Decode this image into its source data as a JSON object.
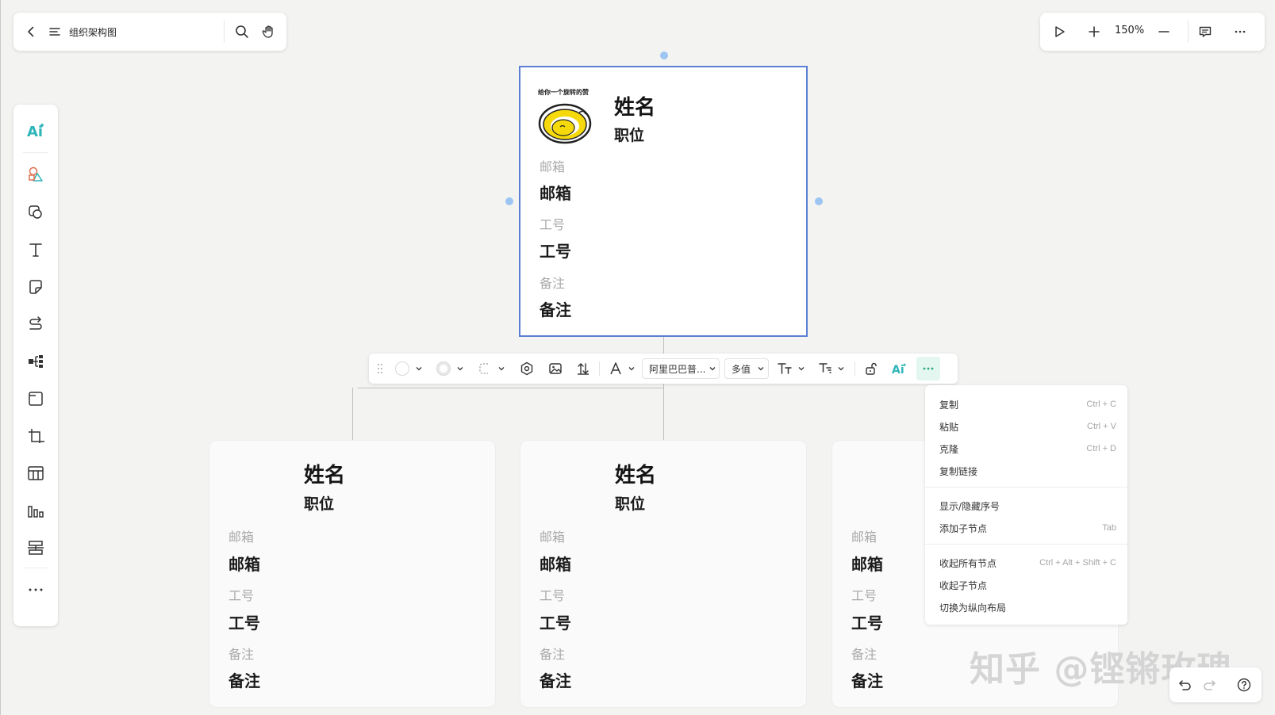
{
  "header": {
    "title": "组织架构图",
    "zoom": "150%"
  },
  "toolbar": {
    "font_name": "阿里巴巴普...",
    "multi_value": "多值"
  },
  "root_card": {
    "sticker_text": "给你一个旋转的赞",
    "name": "姓名",
    "position": "职位",
    "email_label": "邮箱",
    "email_value": "邮箱",
    "id_label": "工号",
    "id_value": "工号",
    "note_label": "备注",
    "note_value": "备注"
  },
  "child_cards": [
    {
      "name": "姓名",
      "position": "职位",
      "email_label": "邮箱",
      "email_value": "邮箱",
      "id_label": "工号",
      "id_value": "工号",
      "note_label": "备注",
      "note_value": "备注"
    },
    {
      "name": "姓名",
      "position": "职位",
      "email_label": "邮箱",
      "email_value": "邮箱",
      "id_label": "工号",
      "id_value": "工号",
      "note_label": "备注",
      "note_value": "备注"
    },
    {
      "email_label": "邮箱",
      "email_value": "邮箱",
      "id_label": "工号",
      "id_value": "工号",
      "note_label": "备注",
      "note_value": "备注"
    }
  ],
  "context_menu": {
    "items": [
      {
        "label": "复制",
        "shortcut": "Ctrl + C"
      },
      {
        "label": "粘贴",
        "shortcut": "Ctrl + V"
      },
      {
        "label": "克隆",
        "shortcut": "Ctrl + D"
      },
      {
        "label": "复制链接",
        "shortcut": ""
      },
      {
        "label": "显示/隐藏序号",
        "shortcut": ""
      },
      {
        "label": "添加子节点",
        "shortcut": "Tab"
      },
      {
        "label": "收起所有节点",
        "shortcut": "Ctrl + Alt + Shift + C"
      },
      {
        "label": "收起子节点",
        "shortcut": ""
      },
      {
        "label": "切换为纵向布局",
        "shortcut": ""
      }
    ]
  },
  "watermark": "知乎 @铿锵玫瑰",
  "colors": {
    "selection_border": "#5b7fd4",
    "handle": "#9cc5f2",
    "ai_accent": "#2db5b8",
    "more_button_bg": "#e3f6ef"
  }
}
